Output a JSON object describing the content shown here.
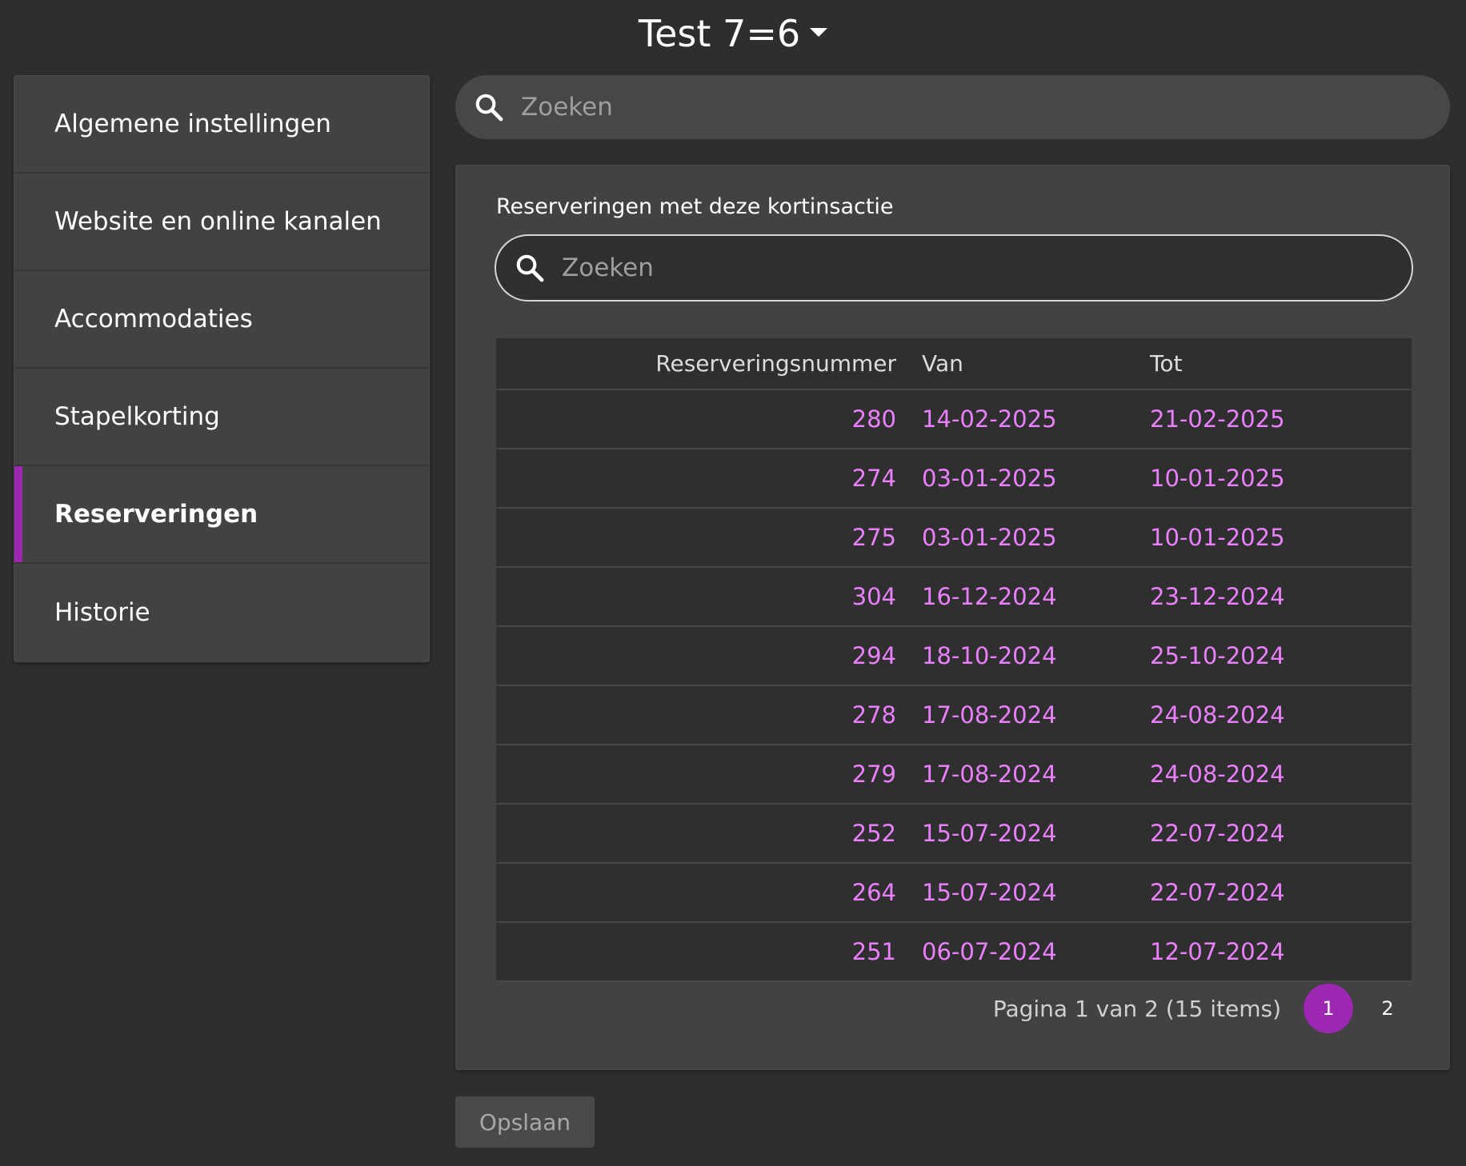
{
  "header": {
    "title": "Test 7=6",
    "caret_icon": "caret-down-icon"
  },
  "sidebar": {
    "items": [
      {
        "label": "Algemene instellingen",
        "active": false
      },
      {
        "label": "Website en online kanalen",
        "active": false
      },
      {
        "label": "Accommodaties",
        "active": false
      },
      {
        "label": "Stapelkorting",
        "active": false
      },
      {
        "label": "Reserveringen",
        "active": true
      },
      {
        "label": "Historie",
        "active": false
      }
    ]
  },
  "top_search": {
    "placeholder": "Zoeken",
    "value": "",
    "icon": "search-icon"
  },
  "panel": {
    "label": "Reserveringen met deze kortinsactie",
    "search": {
      "placeholder": "Zoeken",
      "value": "",
      "icon": "search-icon"
    },
    "table": {
      "columns": [
        "Reserveringsnummer",
        "Van",
        "Tot"
      ],
      "rows": [
        {
          "nummer": "280",
          "van": "14-02-2025",
          "tot": "21-02-2025"
        },
        {
          "nummer": "274",
          "van": "03-01-2025",
          "tot": "10-01-2025"
        },
        {
          "nummer": "275",
          "van": "03-01-2025",
          "tot": "10-01-2025"
        },
        {
          "nummer": "304",
          "van": "16-12-2024",
          "tot": "23-12-2024"
        },
        {
          "nummer": "294",
          "van": "18-10-2024",
          "tot": "25-10-2024"
        },
        {
          "nummer": "278",
          "van": "17-08-2024",
          "tot": "24-08-2024"
        },
        {
          "nummer": "279",
          "van": "17-08-2024",
          "tot": "24-08-2024"
        },
        {
          "nummer": "252",
          "van": "15-07-2024",
          "tot": "22-07-2024"
        },
        {
          "nummer": "264",
          "van": "15-07-2024",
          "tot": "22-07-2024"
        },
        {
          "nummer": "251",
          "van": "06-07-2024",
          "tot": "12-07-2024"
        }
      ]
    },
    "pagination": {
      "info": "Pagina 1 van 2 (15 items)",
      "pages": [
        "1",
        "2"
      ],
      "current": "1"
    }
  },
  "footer": {
    "save_label": "Opslaan"
  },
  "colors": {
    "background": "#2e2e2e",
    "accent": "#9c27b0",
    "link": "#ea80fc",
    "panel": "#424242"
  }
}
